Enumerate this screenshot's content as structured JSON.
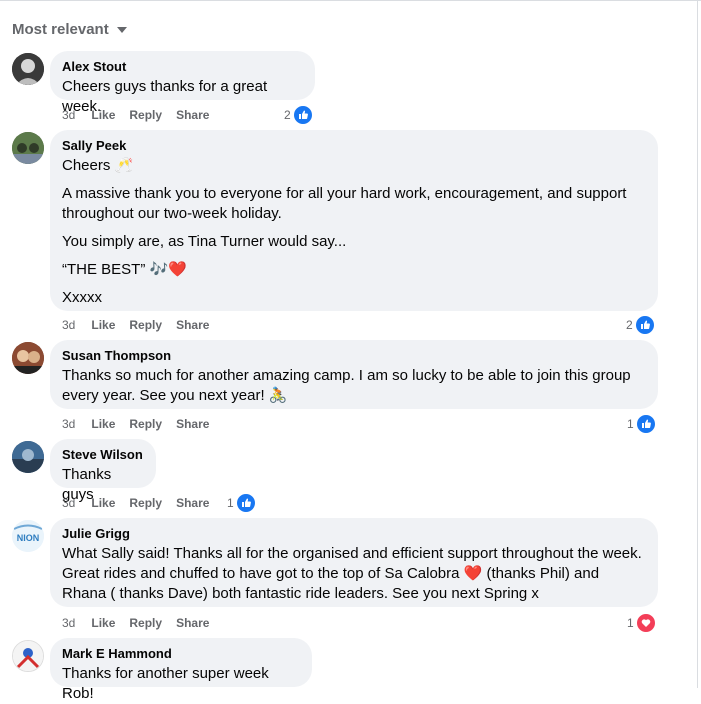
{
  "sort": {
    "label": "Most relevant"
  },
  "comments": [
    {
      "author": "Alex Stout",
      "paragraphs": [
        "Cheers guys thanks for a great week."
      ],
      "time": "3d",
      "like": "Like",
      "reply": "Reply",
      "share": "Share",
      "reaction_count": "2",
      "reaction": "like-icon"
    },
    {
      "author": "Sally Peek",
      "paragraphs": [
        "Cheers 🥂",
        "A massive thank you to everyone for all your hard work, encouragement, and support throughout our two-week holiday.",
        "You simply are, as Tina Turner would say...",
        "“THE BEST” 🎶❤️",
        "Xxxxx"
      ],
      "time": "3d",
      "like": "Like",
      "reply": "Reply",
      "share": "Share",
      "reaction_count": "2",
      "reaction": "like-icon"
    },
    {
      "author": "Susan Thompson",
      "paragraphs": [
        "Thanks so much for another amazing camp. I am so lucky to be able to join this group every year. See you next year! 🚴"
      ],
      "time": "3d",
      "like": "Like",
      "reply": "Reply",
      "share": "Share",
      "reaction_count": "1",
      "reaction": "like-icon"
    },
    {
      "author": "Steve Wilson",
      "paragraphs": [
        "Thanks guys"
      ],
      "time": "3d",
      "like": "Like",
      "reply": "Reply",
      "share": "Share",
      "reaction_count": "1",
      "reaction": "like-icon"
    },
    {
      "author": "Julie Grigg",
      "paragraphs": [
        "What Sally said! Thanks all for the organised and efficient support throughout the week. Great rides and chuffed to have got to the top of Sa Calobra ❤️ (thanks Phil) and Rhana ( thanks Dave) both fantastic ride leaders. See you next Spring x"
      ],
      "time": "3d",
      "like": "Like",
      "reply": "Reply",
      "share": "Share",
      "reaction_count": "1",
      "reaction": "heart-icon"
    },
    {
      "author": "Mark E Hammond",
      "paragraphs": [
        "Thanks for another super week Rob!"
      ]
    }
  ],
  "avatar_labels": {
    "julie": "NION"
  },
  "colors": {
    "like_blue": "#1877f2",
    "heart_red": "#f33e58",
    "bubble": "#f0f2f5",
    "muted": "#65676b"
  }
}
